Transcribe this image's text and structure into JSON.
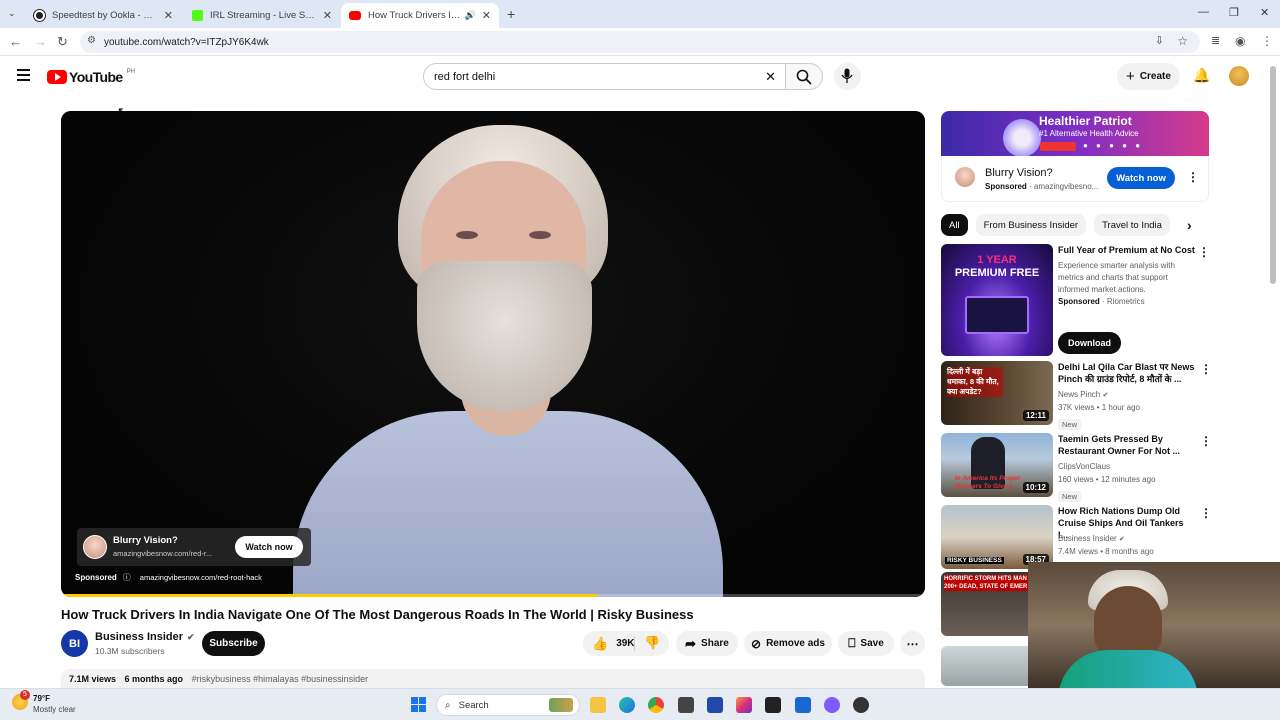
{
  "browser": {
    "tabs": [
      {
        "title": "Speedtest by Ookla - The Globa",
        "color": "#222"
      },
      {
        "title": "IRL Streaming - Live Streams on",
        "color": "#53fc18"
      },
      {
        "title": "How Truck Drivers In India N",
        "color": "#ff0000"
      }
    ],
    "url": "youtube.com/watch?v=ITZpJY6K4wk"
  },
  "youtube": {
    "logo_text": "YouTube",
    "region": "PH",
    "search_value": "red fort delhi",
    "create_label": "Create"
  },
  "player": {
    "ad_title": "Blurry Vision?",
    "ad_domain": "amazingvibesnow.com/red-r...",
    "ad_button": "Watch now",
    "sponsored_label": "Sponsored",
    "ad_link": "amazingvibesnow.com/red-root-hack"
  },
  "video": {
    "title": "How Truck Drivers In India Navigate One Of The Most Dangerous Roads In The World | Risky Business",
    "channel": "Business Insider",
    "channel_initials": "BI",
    "subscribers": "10.3M subscribers",
    "subscribe_label": "Subscribe",
    "likes": "39K",
    "share_label": "Share",
    "remove_ads_label": "Remove ads",
    "save_label": "Save",
    "views": "7.1M views",
    "age": "6 months ago",
    "tags": "#riskybusiness #himalayas #businessinsider"
  },
  "sidebar_ad": {
    "banner_title": "Healthier Patriot",
    "banner_subtitle": "#1 Alternative Health Advice",
    "title": "Blurry Vision?",
    "sponsored": "Sponsored",
    "domain": "amazingvibesno...",
    "button": "Watch now"
  },
  "chips": [
    "All",
    "From Business Insider",
    "Travel to India"
  ],
  "recommendations": [
    {
      "title": "Full Year of Premium at No Cost",
      "desc": "Experience smarter analysis with metrics and charts that support informed market actions.",
      "sponsored": "Sponsored",
      "advertiser": "Riometrics",
      "button": "Download",
      "thumb_text_1": "1 YEAR",
      "thumb_text_2": "PREMIUM FREE"
    },
    {
      "title": "Delhi Lal Qila Car Blast पर News Pinch की ग्राउंड रिपोर्ट, 8 मौतों के ...",
      "channel": "News Pinch",
      "meta": "37K views • 1 hour ago",
      "badge": "New",
      "duration": "12:11",
      "thumb_text": "दिल्ली में बड़ा धमाका, 8 की मौत, क्या अपडेट?"
    },
    {
      "title": "Taemin Gets Pressed By Restaurant Owner For Not ...",
      "channel": "ClipsVonClaus",
      "meta": "160 views • 12 minutes ago",
      "badge": "New",
      "duration": "10:12",
      "thumb_text": "In America Its Proper Manners To Give a"
    },
    {
      "title": "How Rich Nations Dump Old Cruise Ships And Oil Tankers I...",
      "channel": "Business Insider",
      "meta": "7.4M views • 8 months ago",
      "duration": "18:57",
      "thumb_text": "RISKY BUSINESS"
    },
    {
      "thumb_text": "HORRIFIC STORM HITS MAN 200+ DEAD, STATE OF EMER"
    }
  ],
  "taskbar": {
    "temperature": "79°F",
    "weather": "Mostly clear",
    "search_label": "Search",
    "weather_badge": "5"
  }
}
